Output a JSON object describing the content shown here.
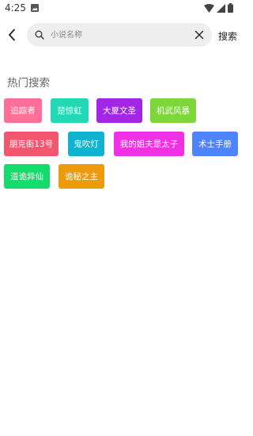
{
  "status_bar": {
    "time": "4:25"
  },
  "search": {
    "placeholder": "小说名称",
    "value": "",
    "submit_label": "搜索"
  },
  "hot": {
    "title": "热门搜索",
    "tags": [
      {
        "label": "追踪者",
        "color": "#ff6f97"
      },
      {
        "label": "楚惊虹",
        "color": "#22d9b6"
      },
      {
        "label": "大夏文圣",
        "color": "#a226e6"
      },
      {
        "label": "机武风暴",
        "color": "#7ed63a"
      },
      {
        "label": "朋克街13号",
        "color": "#f4566e"
      },
      {
        "label": "鬼吹灯",
        "color": "#0fb3d0"
      },
      {
        "label": "我的姐夫是太子",
        "color": "#f030e4"
      },
      {
        "label": "术士手册",
        "color": "#4e84ff"
      },
      {
        "label": "道诡异仙",
        "color": "#13dc6c"
      },
      {
        "label": "诡秘之主",
        "color": "#ee9a0d"
      }
    ]
  }
}
